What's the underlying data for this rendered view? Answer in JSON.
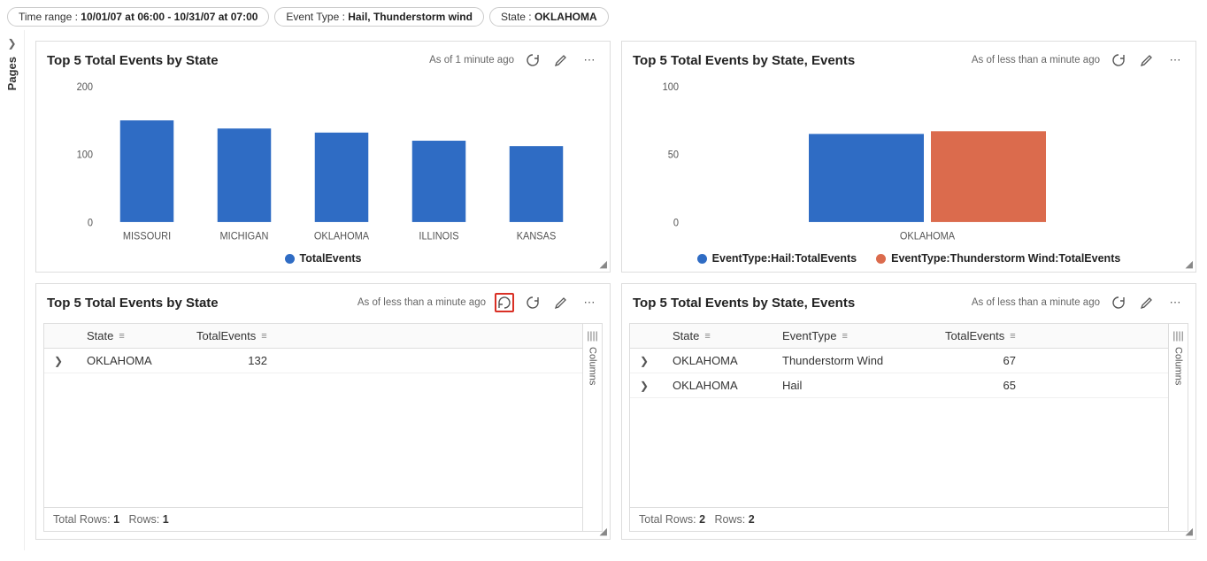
{
  "filters": {
    "time_label": "Time range :",
    "time_value": "10/01/07 at 06:00 - 10/31/07 at 07:00",
    "event_label": "Event Type :",
    "event_value": "Hail, Thunderstorm wind",
    "state_label": "State :",
    "state_value": "OKLAHOMA"
  },
  "pages_label": "Pages",
  "columns_label": "Columns",
  "tiles": {
    "tl": {
      "title": "Top 5 Total Events by State",
      "status": "As of 1 minute ago",
      "legend1": "TotalEvents"
    },
    "tr": {
      "title": "Top 5 Total Events by State, Events",
      "status": "As of less than a minute ago",
      "legend1": "EventType:Hail:TotalEvents",
      "legend2": "EventType:Thunderstorm Wind:TotalEvents"
    },
    "bl": {
      "title": "Top 5 Total Events by State",
      "status": "As of less than a minute ago",
      "col_state": "State",
      "col_total": "TotalEvents",
      "row0_state": "OKLAHOMA",
      "row0_total": "132",
      "footer_a": "Total Rows:",
      "footer_av": "1",
      "footer_b": "Rows:",
      "footer_bv": "1"
    },
    "br": {
      "title": "Top 5 Total Events by State, Events",
      "status": "As of less than a minute ago",
      "col_state": "State",
      "col_type": "EventType",
      "col_total": "TotalEvents",
      "row0_state": "OKLAHOMA",
      "row0_type": "Thunderstorm Wind",
      "row0_total": "67",
      "row1_state": "OKLAHOMA",
      "row1_type": "Hail",
      "row1_total": "65",
      "footer_a": "Total Rows:",
      "footer_av": "2",
      "footer_b": "Rows:",
      "footer_bv": "2"
    }
  },
  "chart_data": [
    {
      "type": "bar",
      "tile": "tl",
      "categories": [
        "MISSOURI",
        "MICHIGAN",
        "OKLAHOMA",
        "ILLINOIS",
        "KANSAS"
      ],
      "values": [
        150,
        138,
        132,
        120,
        112
      ],
      "ylim": [
        0,
        200
      ],
      "yticks": [
        0,
        100,
        200
      ],
      "series_name": "TotalEvents",
      "color": "#2f6cc4"
    },
    {
      "type": "bar",
      "tile": "tr",
      "categories": [
        "OKLAHOMA"
      ],
      "series": [
        {
          "name": "EventType:Hail:TotalEvents",
          "values": [
            65
          ],
          "color": "#2f6cc4"
        },
        {
          "name": "EventType:Thunderstorm Wind:TotalEvents",
          "values": [
            67
          ],
          "color": "#db6b4d"
        }
      ],
      "ylim": [
        0,
        100
      ],
      "yticks": [
        0,
        50,
        100
      ]
    }
  ]
}
